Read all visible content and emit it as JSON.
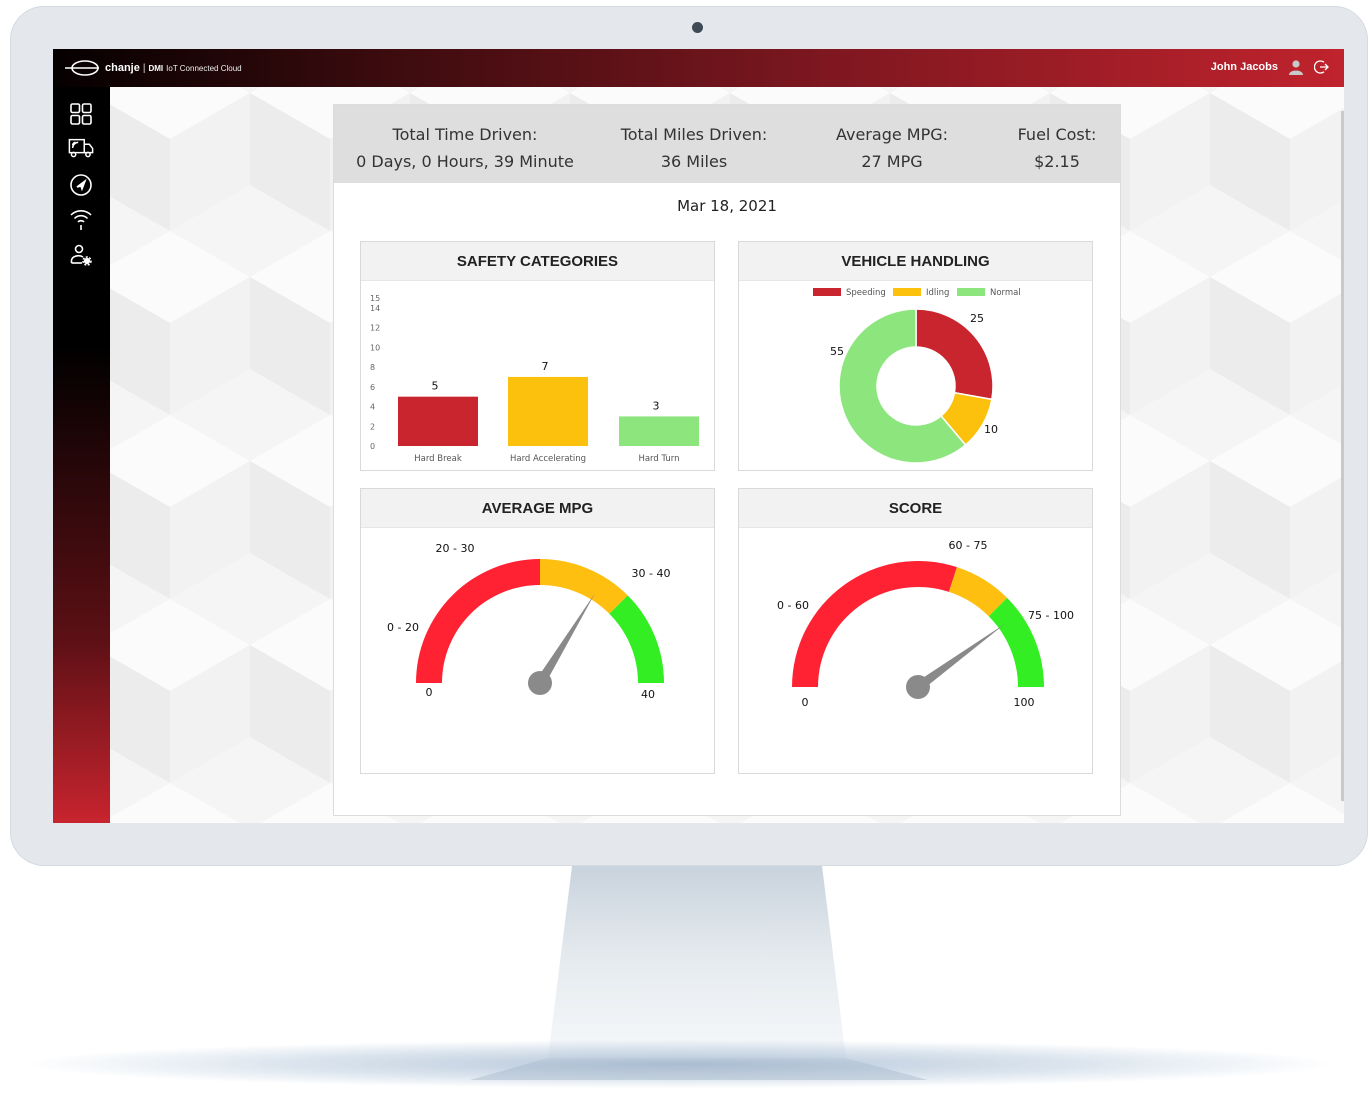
{
  "app": {
    "brand": "chanje",
    "brand_sep": "|",
    "brand_dmi": "DMI",
    "brand_cloud": "IoT Connected Cloud"
  },
  "user": {
    "name": "John Jacobs",
    "avatar_icon": "user-icon",
    "logout_icon": "logout-icon"
  },
  "sidebar": {
    "items": [
      {
        "name": "dashboard",
        "icon": "grid-icon"
      },
      {
        "name": "vehicles",
        "icon": "truck-icon"
      },
      {
        "name": "navigation",
        "icon": "navigation-icon"
      },
      {
        "name": "connectivity",
        "icon": "wifi-icon"
      },
      {
        "name": "user-settings",
        "icon": "user-settings-icon"
      }
    ]
  },
  "stats": [
    {
      "label": "Total Time Driven:",
      "value": "0 Days, 0 Hours, 39 Minute"
    },
    {
      "label": "Total Miles Driven:",
      "value": "36 Miles"
    },
    {
      "label": "Average MPG:",
      "value": "27 MPG"
    },
    {
      "label": "Fuel Cost:",
      "value": "$2.15"
    }
  ],
  "date": "Mar 18, 2021",
  "cards": {
    "safety": "SAFETY CATEGORIES",
    "handling": "VEHICLE HANDLING",
    "mpg": "AVERAGE MPG",
    "score": "SCORE"
  },
  "colors": {
    "red": "#c9252f",
    "yellow": "#fcc10d",
    "green": "#8ce67d",
    "gauge_red": "#ff2233",
    "gauge_yellow": "#ffbf10",
    "gauge_green": "#33ee22"
  },
  "chart_data": [
    {
      "type": "bar",
      "title": "SAFETY CATEGORIES",
      "categories": [
        "Hard Break",
        "Hard Accelerating",
        "Hard Turn"
      ],
      "values": [
        5,
        7,
        3
      ],
      "yticks": [
        "0",
        "2",
        "4",
        "6",
        "8",
        "10",
        "12",
        "14",
        "15"
      ],
      "ylim": [
        0,
        15
      ]
    },
    {
      "type": "pie",
      "title": "VEHICLE HANDLING",
      "categories": [
        "Speeding",
        "Idling",
        "Normal"
      ],
      "values": [
        25,
        10,
        55
      ],
      "legend": "top"
    },
    {
      "type": "gauge",
      "title": "AVERAGE MPG",
      "min": "0",
      "max": "40",
      "bands": [
        {
          "label": "0 - 20",
          "from": 0,
          "to": 20,
          "color": "#ff2233"
        },
        {
          "label": "20 - 30",
          "from": 20,
          "to": 30,
          "color": "#ffbf10"
        },
        {
          "label": "30 - 40",
          "from": 30,
          "to": 40,
          "color": "#33ee22"
        }
      ],
      "value": 27
    },
    {
      "type": "gauge",
      "title": "SCORE",
      "min": "0",
      "max": "100",
      "bands": [
        {
          "label": "0 - 60",
          "from": 0,
          "to": 60,
          "color": "#ff2233"
        },
        {
          "label": "60 - 75",
          "from": 60,
          "to": 75,
          "color": "#ffbf10"
        },
        {
          "label": "75 - 100",
          "from": 75,
          "to": 100,
          "color": "#33ee22"
        }
      ],
      "value": 80
    }
  ]
}
